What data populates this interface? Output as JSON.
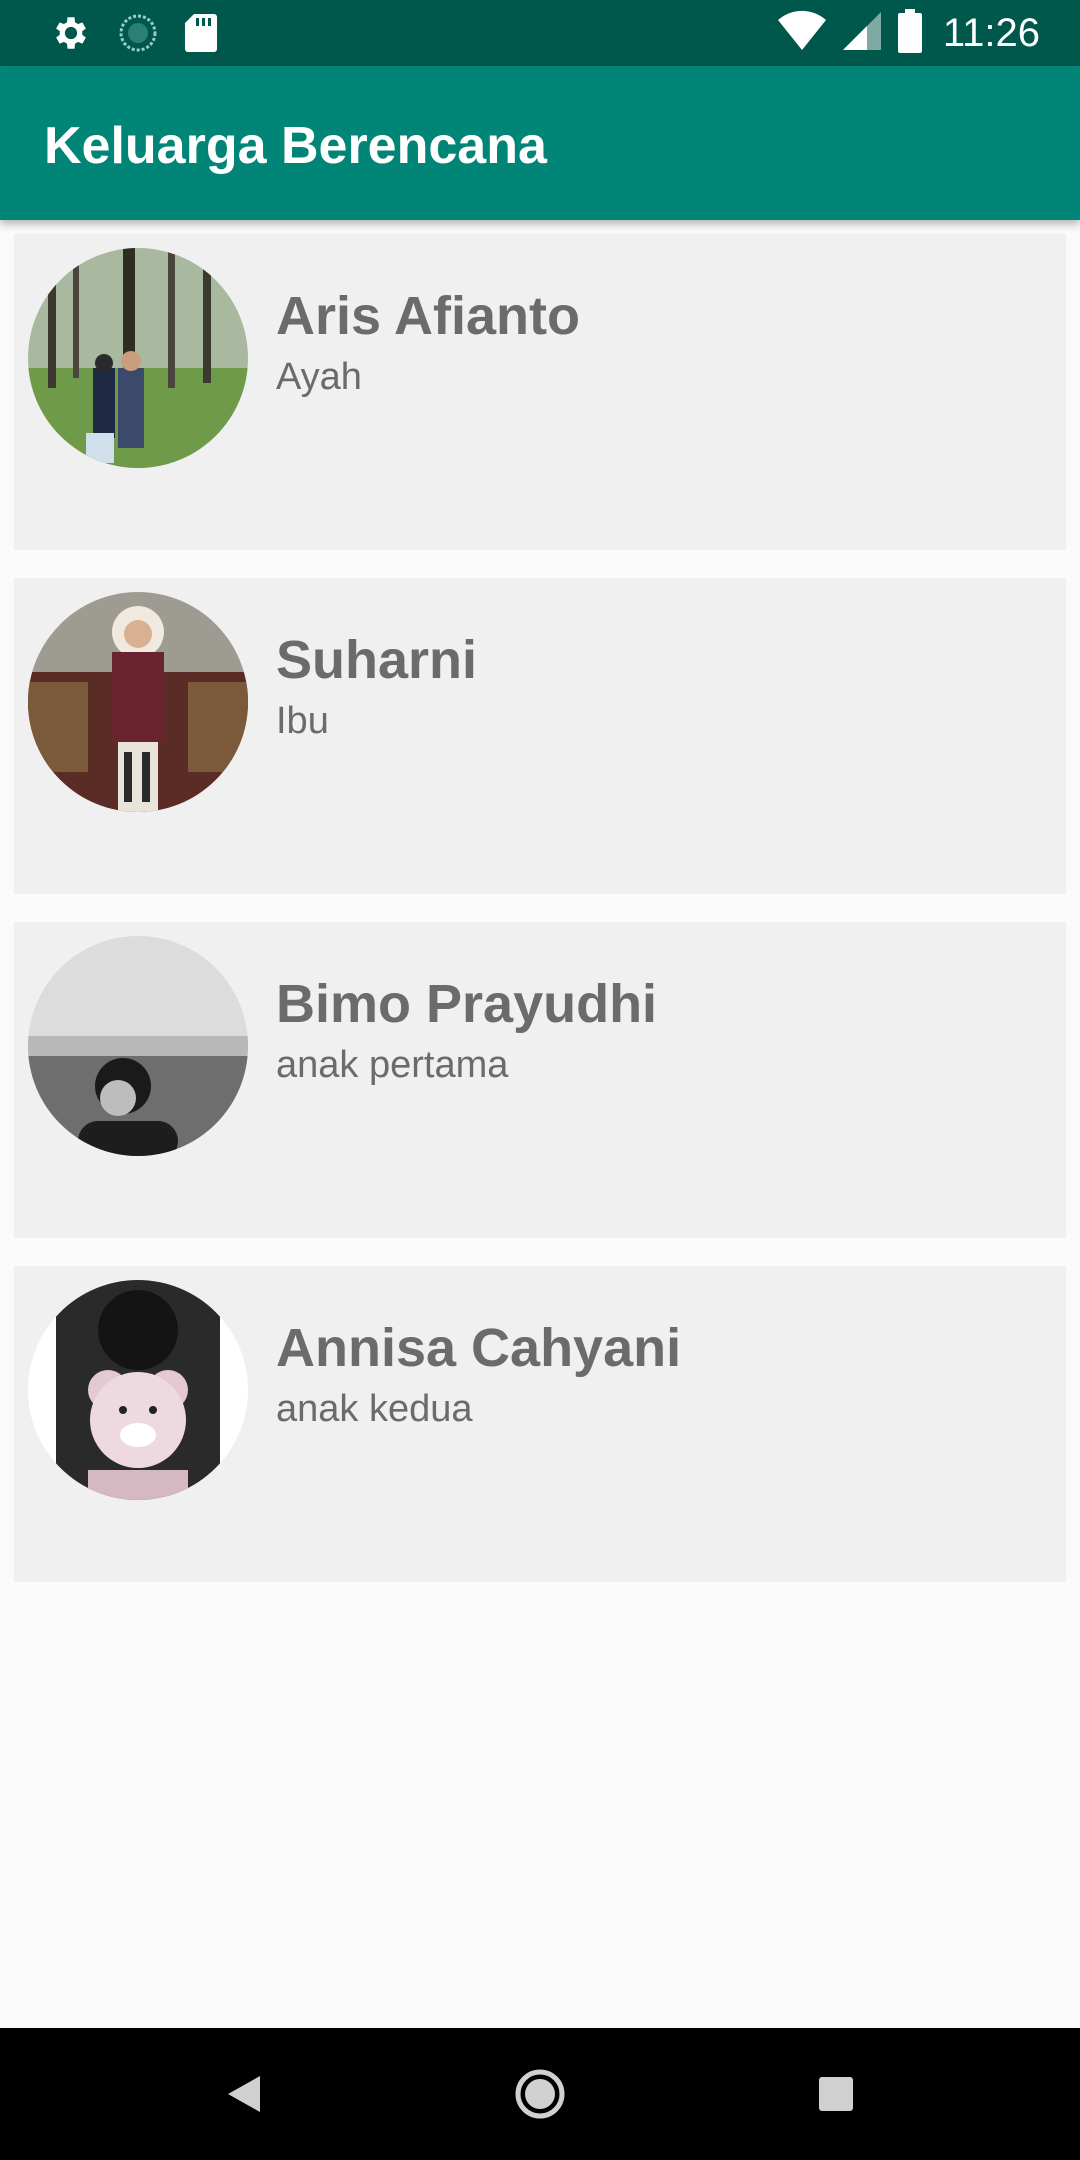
{
  "status_bar": {
    "time": "11:26",
    "left_icons": [
      "settings-icon",
      "sync-icon",
      "sd-card-icon"
    ],
    "right_icons": [
      "wifi-icon",
      "signal-icon",
      "battery-icon"
    ]
  },
  "app_bar": {
    "title": "Keluarga Berencana",
    "color": "#008577",
    "status_color": "#00574b"
  },
  "members": [
    {
      "name": "Aris Afianto",
      "role": "Ayah"
    },
    {
      "name": "Suharni",
      "role": "Ibu"
    },
    {
      "name": "Bimo Prayudhi",
      "role": "anak pertama"
    },
    {
      "name": "Annisa Cahyani",
      "role": "anak kedua"
    }
  ],
  "nav_bar": {
    "buttons": [
      "back-icon",
      "home-icon",
      "recents-icon"
    ]
  }
}
